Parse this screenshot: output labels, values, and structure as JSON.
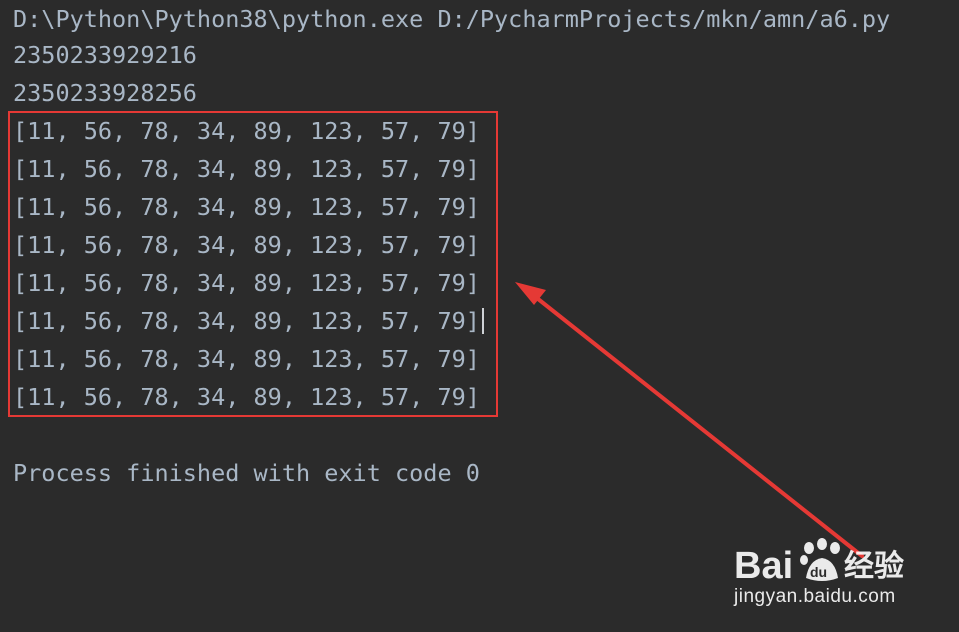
{
  "console": {
    "command": "D:\\Python\\Python38\\python.exe D:/PycharmProjects/mkn/amn/a6.py",
    "id_lines": [
      "2350233929216",
      "2350233928256"
    ],
    "list_lines": [
      "[11, 56, 78, 34, 89, 123, 57, 79]",
      "[11, 56, 78, 34, 89, 123, 57, 79]",
      "[11, 56, 78, 34, 89, 123, 57, 79]",
      "[11, 56, 78, 34, 89, 123, 57, 79]",
      "[11, 56, 78, 34, 89, 123, 57, 79]",
      "[11, 56, 78, 34, 89, 123, 57, 79]",
      "[11, 56, 78, 34, 89, 123, 57, 79]",
      "[11, 56, 78, 34, 89, 123, 57, 79]"
    ],
    "exit_message": "Process finished with exit code 0"
  },
  "annotation": {
    "box_color": "#e53935",
    "arrow_color": "#e53935"
  },
  "watermark": {
    "logo_text": "Baidu经验",
    "url": "jingyan.baidu.com"
  },
  "colors": {
    "background": "#2b2b2b",
    "text": "#a9b7c6"
  }
}
